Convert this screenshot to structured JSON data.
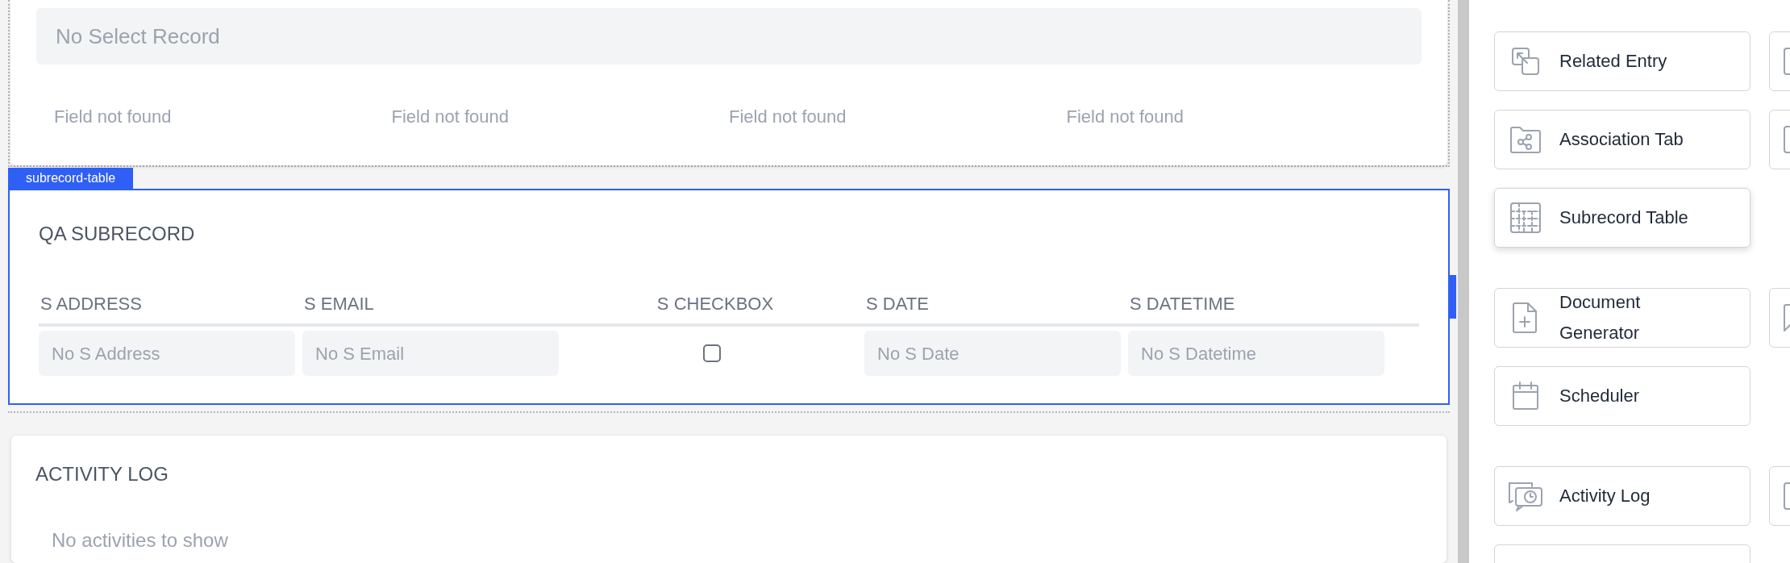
{
  "top_card": {
    "select_placeholder": "No Select Record",
    "fields": [
      "Field not found",
      "Field not found",
      "Field not found",
      "Field not found"
    ]
  },
  "subrecord": {
    "tag": "subrecord-table",
    "title": "QA SUBRECORD",
    "selected": true,
    "columns": [
      {
        "label": "S ADDRESS",
        "kind": "text",
        "placeholder": "No S Address"
      },
      {
        "label": "S EMAIL",
        "kind": "text",
        "placeholder": "No S Email"
      },
      {
        "label": "S CHECKBOX",
        "kind": "checkbox",
        "checked": false
      },
      {
        "label": "S DATE",
        "kind": "text",
        "placeholder": "No S Date"
      },
      {
        "label": "S DATETIME",
        "kind": "text",
        "placeholder": "No S Datetime"
      }
    ]
  },
  "activity_log": {
    "title": "ACTIVITY LOG",
    "empty_text": "No activities to show"
  },
  "component_groups": [
    [
      [
        {
          "kind": "button",
          "label": "Related Entry",
          "selected": false
        },
        {
          "kind": "clipped"
        }
      ],
      [
        {
          "kind": "button",
          "label": "Association Tab",
          "selected": false
        },
        {
          "kind": "clipped"
        }
      ],
      [
        {
          "kind": "button",
          "label": "Subrecord Table",
          "selected": true
        }
      ]
    ],
    [
      [
        {
          "kind": "button",
          "label": "Document Generator",
          "selected": false
        },
        {
          "kind": "clipped"
        }
      ],
      [
        {
          "kind": "button",
          "label": "Scheduler",
          "selected": false
        }
      ]
    ],
    [
      [
        {
          "kind": "button",
          "label": "Activity Log",
          "selected": false
        },
        {
          "kind": "clipped"
        }
      ],
      [
        {
          "kind": "clipped"
        }
      ]
    ]
  ]
}
